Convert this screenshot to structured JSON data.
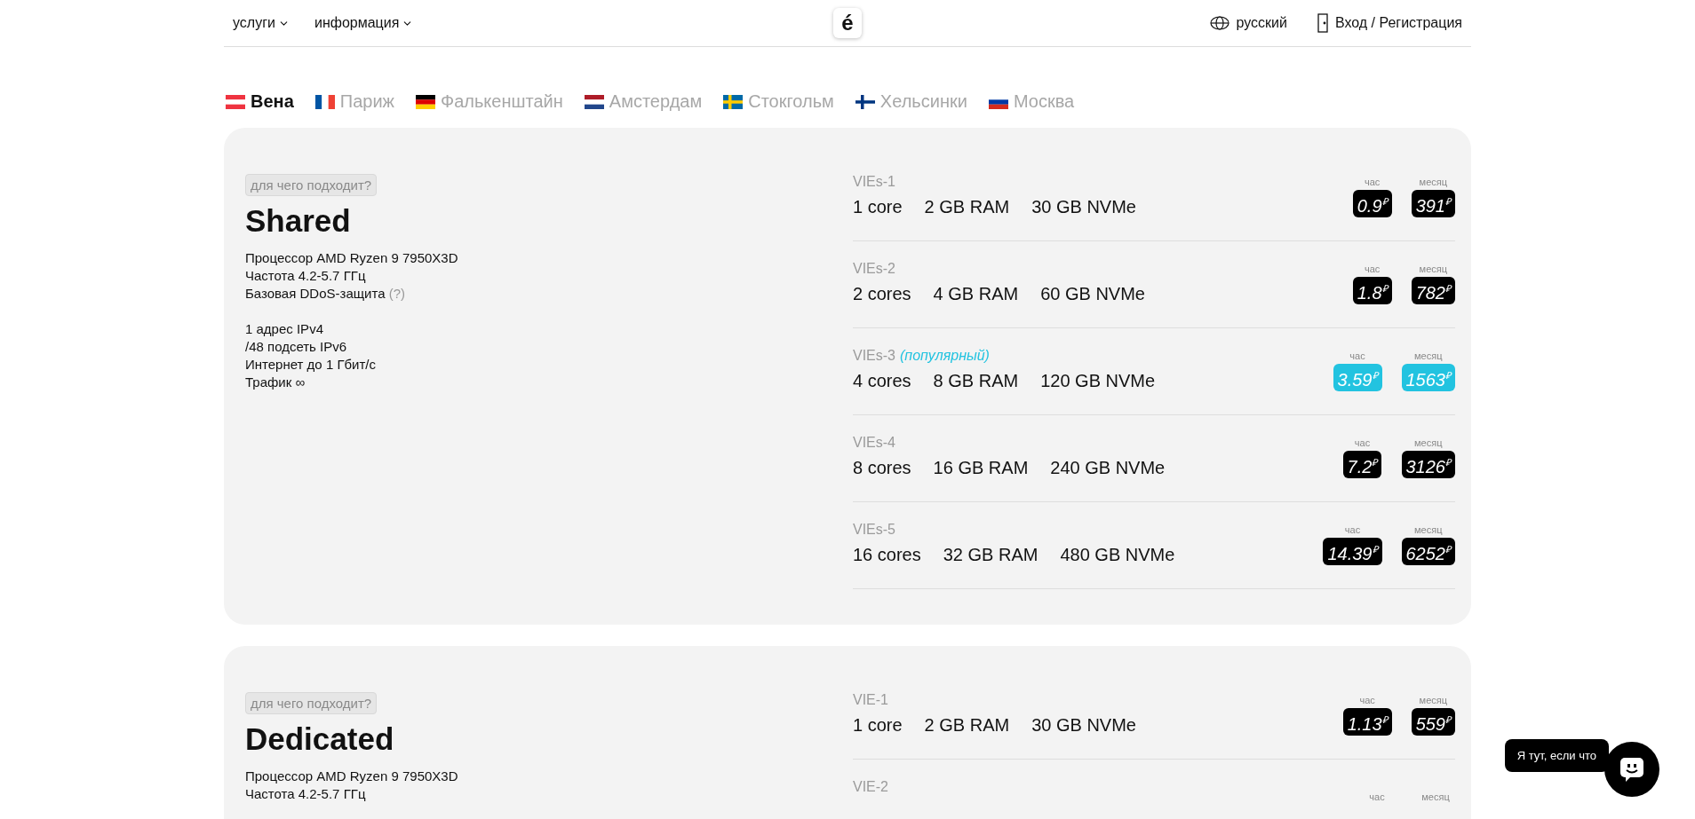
{
  "header": {
    "nav": [
      {
        "label": "услуги"
      },
      {
        "label": "информация"
      }
    ],
    "logo": "é",
    "language": "русский",
    "login": "Вход / Регистрация"
  },
  "cities": [
    {
      "label": "Вена",
      "selected": true
    },
    {
      "label": "Париж",
      "selected": false
    },
    {
      "label": "Фалькенштайн",
      "selected": false
    },
    {
      "label": "Амстердам",
      "selected": false
    },
    {
      "label": "Стокгольм",
      "selected": false
    },
    {
      "label": "Хельсинки",
      "selected": false
    },
    {
      "label": "Москва",
      "selected": false
    }
  ],
  "cards": [
    {
      "badge": "для чего подходит?",
      "title": "Shared",
      "feature_groups": [
        [
          {
            "text": "Процессор AMD Ryzen 9 7950X3D"
          },
          {
            "text": "Частота 4.2-5.7 ГГц"
          },
          {
            "text": "Базовая DDoS-защита",
            "hint": "(?)"
          }
        ],
        [
          {
            "text": "1 адрес IPv4"
          },
          {
            "text": "/48 подсеть IPv6"
          },
          {
            "text": "Интернет до 1 Гбит/с"
          },
          {
            "text": "Трафик ∞"
          }
        ]
      ],
      "plans": [
        {
          "name": "VIEs-1",
          "color": "#000000",
          "specs": [
            "1 core",
            "2 GB RAM",
            "30 GB NVMe"
          ],
          "prices": [
            {
              "label": "час",
              "value": "0.9",
              "currency": "₽"
            },
            {
              "label": "месяц",
              "value": "391",
              "currency": "₽"
            }
          ]
        },
        {
          "name": "VIEs-2",
          "color": "#000000",
          "specs": [
            "2 cores",
            "4 GB RAM",
            "60 GB NVMe"
          ],
          "prices": [
            {
              "label": "час",
              "value": "1.8",
              "currency": "₽"
            },
            {
              "label": "месяц",
              "value": "782",
              "currency": "₽"
            }
          ]
        },
        {
          "name": "VIEs-3",
          "tag": "(популярный)",
          "color": "#22c3e0",
          "specs": [
            "4 cores",
            "8 GB RAM",
            "120 GB NVMe"
          ],
          "prices": [
            {
              "label": "час",
              "value": "3.59",
              "currency": "₽"
            },
            {
              "label": "месяц",
              "value": "1563",
              "currency": "₽"
            }
          ]
        },
        {
          "name": "VIEs-4",
          "color": "#000000",
          "specs": [
            "8 cores",
            "16 GB RAM",
            "240 GB NVMe"
          ],
          "prices": [
            {
              "label": "час",
              "value": "7.2",
              "currency": "₽"
            },
            {
              "label": "месяц",
              "value": "3126",
              "currency": "₽"
            }
          ]
        },
        {
          "name": "VIEs-5",
          "color": "#000000",
          "specs": [
            "16 cores",
            "32 GB RAM",
            "480 GB NVMe"
          ],
          "prices": [
            {
              "label": "час",
              "value": "14.39",
              "currency": "₽"
            },
            {
              "label": "месяц",
              "value": "6252",
              "currency": "₽"
            }
          ]
        }
      ]
    },
    {
      "badge": "для чего подходит?",
      "title": "Dedicated",
      "feature_groups": [
        [
          {
            "text": "Процессор AMD Ryzen 9 7950X3D"
          },
          {
            "text": "Частота 4.2-5.7 ГГц"
          }
        ]
      ],
      "plans": [
        {
          "name": "VIE-1",
          "color": "#000000",
          "specs": [
            "1 core",
            "2 GB RAM",
            "30 GB NVMe"
          ],
          "prices": [
            {
              "label": "час",
              "value": "1.13",
              "currency": "₽"
            },
            {
              "label": "месяц",
              "value": "559",
              "currency": "₽"
            }
          ]
        },
        {
          "name": "VIE-2",
          "prices": [
            {
              "label": "час"
            },
            {
              "label": "месяц"
            }
          ]
        }
      ]
    }
  ],
  "chat": {
    "tooltip": "Я тут, если что"
  }
}
